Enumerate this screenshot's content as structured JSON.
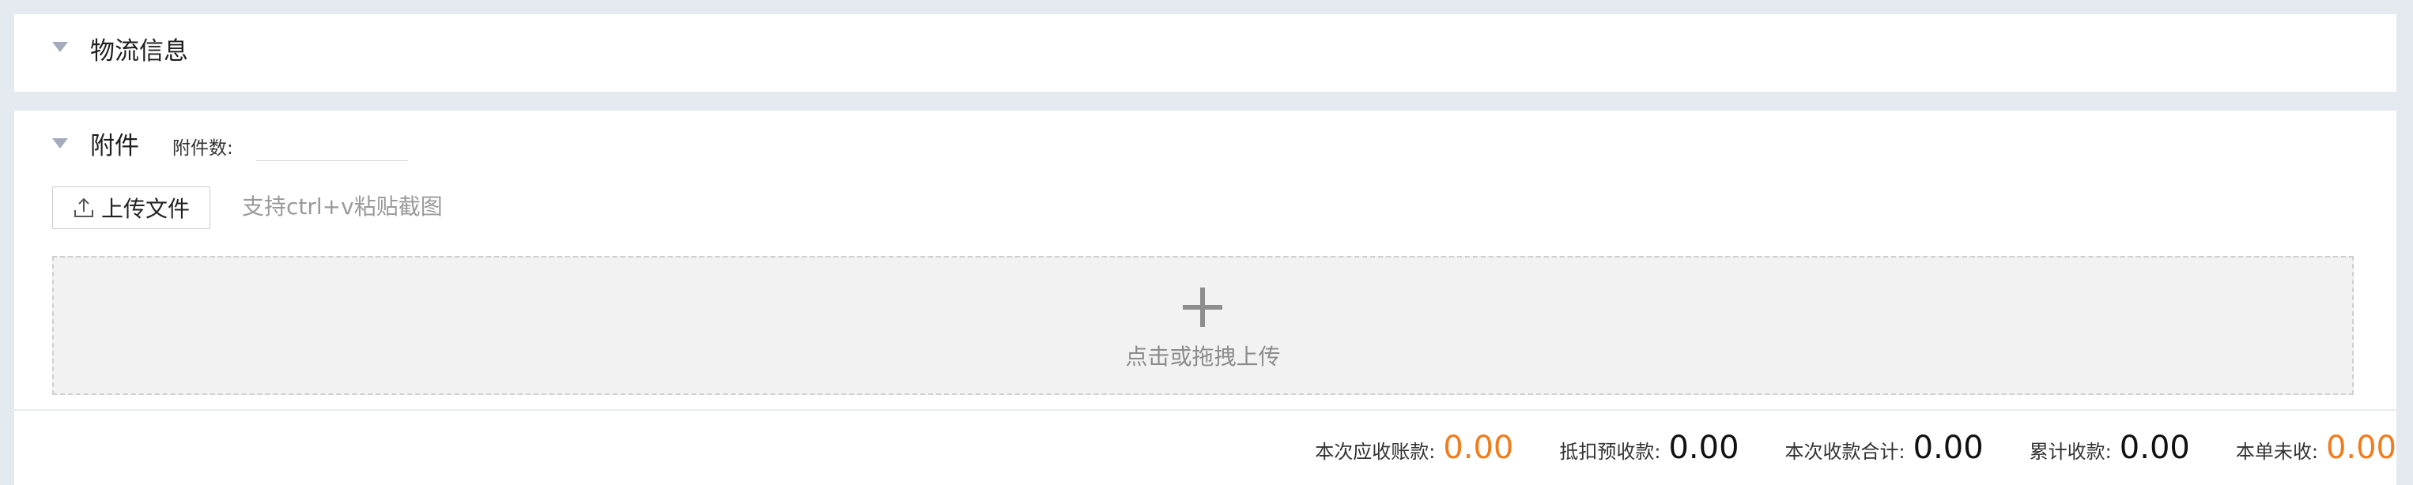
{
  "logistics": {
    "title": "物流信息"
  },
  "attachments": {
    "title": "附件",
    "count_label": "附件数:",
    "count_value": "",
    "upload_button_label": "上传文件",
    "paste_hint": "支持ctrl+v粘贴截图",
    "dropzone_text": "点击或拖拽上传"
  },
  "totals": [
    {
      "label": "本次应收账款:",
      "value": "0.00",
      "color": "#f07c1d"
    },
    {
      "label": "抵扣预收款:",
      "value": "0.00",
      "color": "#111111"
    },
    {
      "label": "本次收款合计:",
      "value": "0.00",
      "color": "#111111"
    },
    {
      "label": "累计收款:",
      "value": "0.00",
      "color": "#111111"
    },
    {
      "label": "本单未收:",
      "value": "0.00",
      "color": "#f07c1d"
    }
  ],
  "colors": {
    "accent_orange": "#f07c1d",
    "page_background": "#e5e9f0"
  },
  "icons": {
    "collapse": "caret-down-icon",
    "upload": "upload-icon",
    "add": "plus-icon"
  }
}
